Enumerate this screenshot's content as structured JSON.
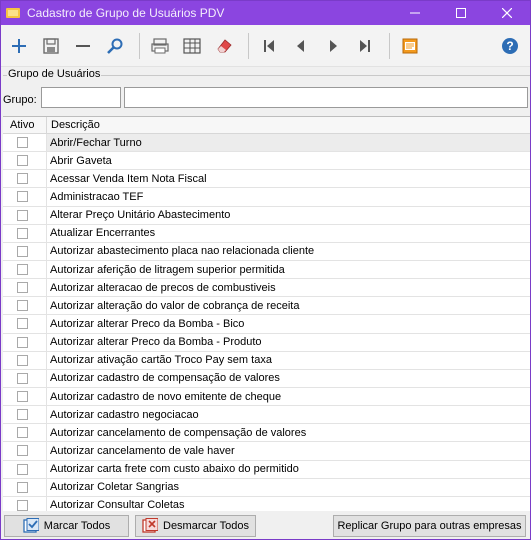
{
  "window": {
    "title": "Cadastro de Grupo de Usuários PDV",
    "accent": "#8b45e0"
  },
  "toolbar": {
    "buttons": [
      {
        "icon": "plus-icon",
        "name": "new-button"
      },
      {
        "icon": "save-icon",
        "name": "save-button"
      },
      {
        "icon": "minus-icon",
        "name": "delete-button"
      },
      {
        "icon": "search-icon",
        "name": "search-button"
      },
      {
        "icon": "print-icon",
        "name": "print-button"
      },
      {
        "icon": "grid-icon",
        "name": "grid-view-button"
      },
      {
        "icon": "eraser-icon",
        "name": "clear-button"
      },
      {
        "icon": "first-record-icon",
        "name": "first-button"
      },
      {
        "icon": "prev-record-icon",
        "name": "prev-button"
      },
      {
        "icon": "next-record-icon",
        "name": "next-button"
      },
      {
        "icon": "last-record-icon",
        "name": "last-button"
      },
      {
        "icon": "export-icon",
        "name": "export-button"
      },
      {
        "icon": "help-icon",
        "name": "help-button"
      }
    ]
  },
  "group": {
    "legend": "Grupo de Usuários",
    "field_label": "Grupo:",
    "code_value": "",
    "name_value": ""
  },
  "grid": {
    "col_ativo": "Ativo",
    "col_descricao": "Descrição",
    "rows": [
      {
        "ativo": false,
        "descricao": "Abrir/Fechar Turno"
      },
      {
        "ativo": false,
        "descricao": "Abrir Gaveta"
      },
      {
        "ativo": false,
        "descricao": "Acessar Venda Item Nota Fiscal"
      },
      {
        "ativo": false,
        "descricao": "Administracao TEF"
      },
      {
        "ativo": false,
        "descricao": "Alterar Preço Unitário Abastecimento"
      },
      {
        "ativo": false,
        "descricao": "Atualizar Encerrantes"
      },
      {
        "ativo": false,
        "descricao": "Autorizar abastecimento placa nao relacionada cliente"
      },
      {
        "ativo": false,
        "descricao": "Autorizar aferição de litragem superior permitida"
      },
      {
        "ativo": false,
        "descricao": "Autorizar alteracao de precos de combustiveis"
      },
      {
        "ativo": false,
        "descricao": "Autorizar alteração do valor de cobrança de receita"
      },
      {
        "ativo": false,
        "descricao": "Autorizar alterar Preco da Bomba - Bico"
      },
      {
        "ativo": false,
        "descricao": "Autorizar alterar Preco da Bomba - Produto"
      },
      {
        "ativo": false,
        "descricao": "Autorizar ativação cartão Troco Pay sem taxa"
      },
      {
        "ativo": false,
        "descricao": "Autorizar cadastro de compensação de valores"
      },
      {
        "ativo": false,
        "descricao": "Autorizar cadastro de novo emitente de cheque"
      },
      {
        "ativo": false,
        "descricao": "Autorizar cadastro negociacao"
      },
      {
        "ativo": false,
        "descricao": "Autorizar cancelamento de compensação de valores"
      },
      {
        "ativo": false,
        "descricao": "Autorizar cancelamento de vale haver"
      },
      {
        "ativo": false,
        "descricao": "Autorizar carta frete com custo abaixo do permitido"
      },
      {
        "ativo": false,
        "descricao": "Autorizar Coletar Sangrias"
      },
      {
        "ativo": false,
        "descricao": "Autorizar Consultar Coletas"
      }
    ]
  },
  "footer": {
    "marcar": "Marcar Todos",
    "desmarcar": "Desmarcar Todos",
    "replicar": "Replicar Grupo para outras empresas"
  }
}
